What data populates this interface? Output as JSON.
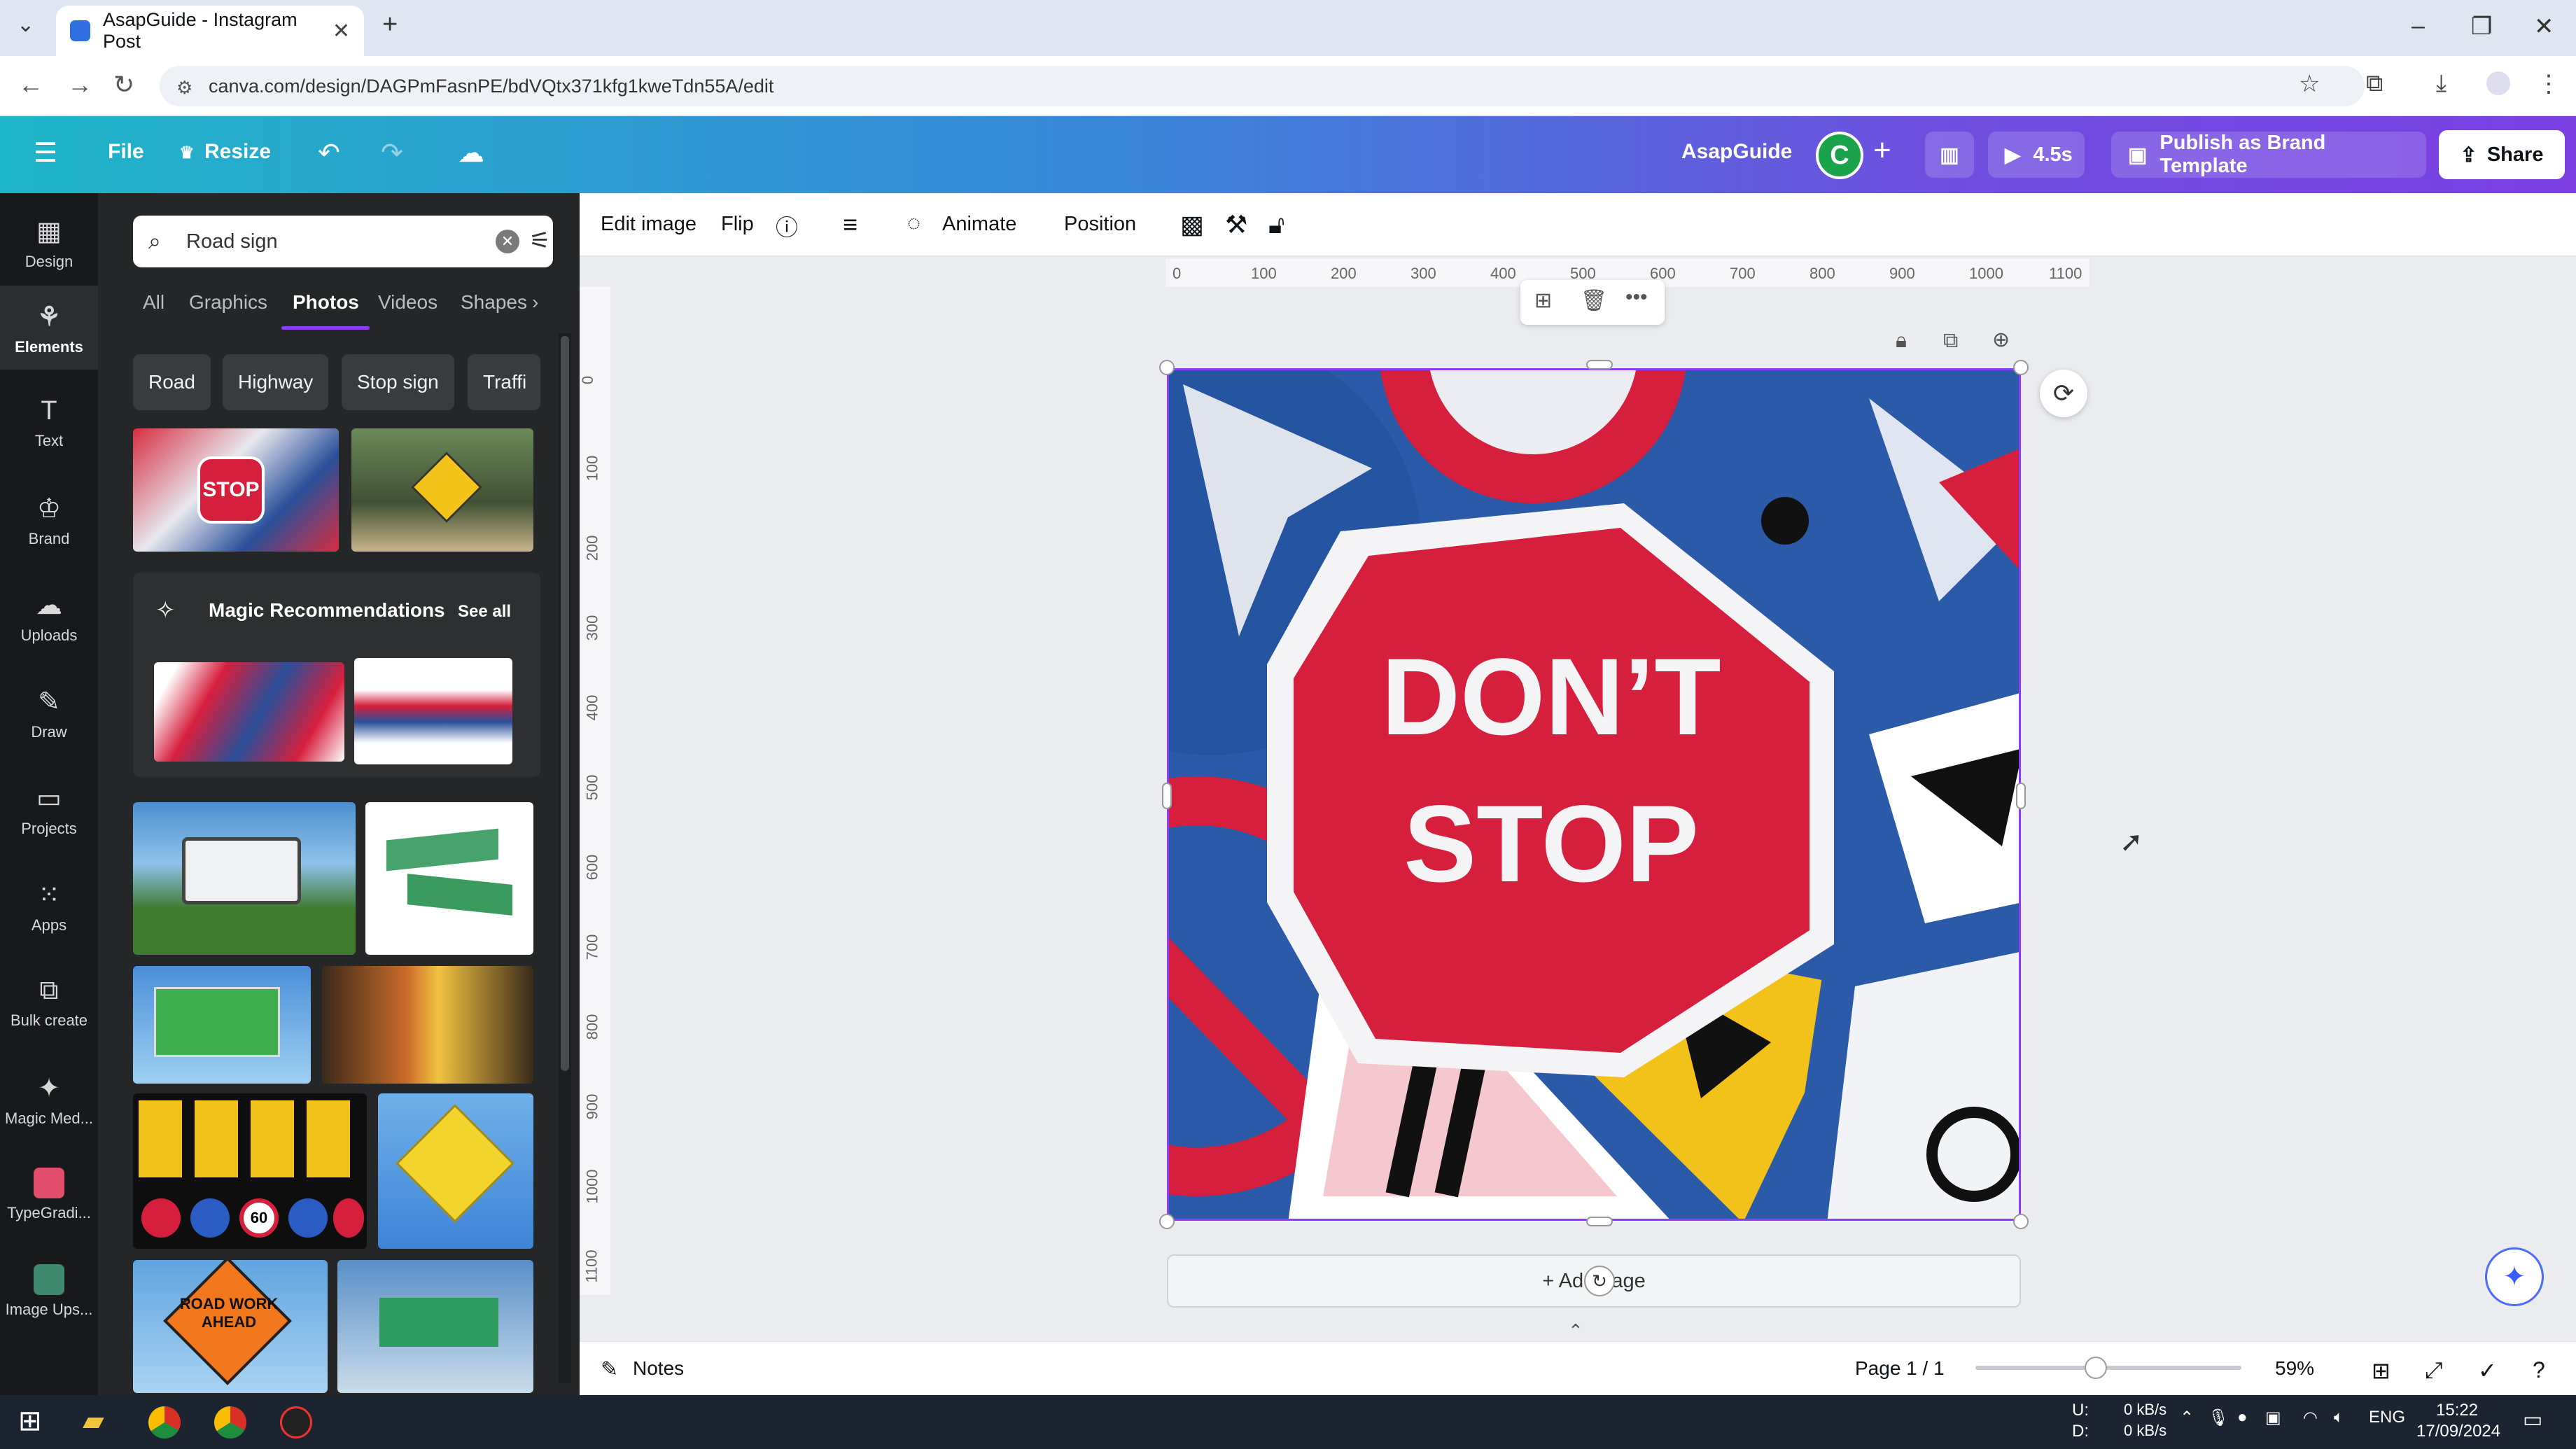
{
  "browser": {
    "tab_title": "AsapGuide - Instagram Post",
    "new_tab": "+",
    "url": "canva.com/design/DAGPmFasnPE/bdVQtx371kfg1kweTdn55A/edit",
    "window_controls": [
      "–",
      "❐",
      "✕"
    ]
  },
  "topbar": {
    "file": "File",
    "resize": "Resize",
    "brand_name": "AsapGuide",
    "avatar_letter": "C",
    "play_time": "4.5s",
    "publish": "Publish as Brand Template",
    "share": "Share"
  },
  "rail": {
    "items": [
      {
        "label": "Design",
        "icon": "design-icon"
      },
      {
        "label": "Elements",
        "icon": "elements-icon"
      },
      {
        "label": "Text",
        "icon": "text-icon"
      },
      {
        "label": "Brand",
        "icon": "brand-icon"
      },
      {
        "label": "Uploads",
        "icon": "uploads-icon"
      },
      {
        "label": "Draw",
        "icon": "draw-icon"
      },
      {
        "label": "Projects",
        "icon": "projects-icon"
      },
      {
        "label": "Apps",
        "icon": "apps-icon"
      },
      {
        "label": "Bulk create",
        "icon": "bulk-create-icon"
      },
      {
        "label": "Magic Med...",
        "icon": "magic-media-icon"
      },
      {
        "label": "TypeGradi...",
        "icon": "typegradient-icon"
      },
      {
        "label": "Image Ups...",
        "icon": "image-upscaler-icon"
      }
    ]
  },
  "panel": {
    "search_value": "Road sign",
    "tabs": [
      "All",
      "Graphics",
      "Photos",
      "Videos",
      "Shapes"
    ],
    "chips": [
      "Road",
      "Highway",
      "Stop sign",
      "Traffi"
    ],
    "magic_title": "Magic Recommendations",
    "see_all": "See all",
    "thumb_texts": {
      "stop": "STOP",
      "road_work": "ROAD WORK AHEAD",
      "speed": "60"
    }
  },
  "toolbar": {
    "edit_image": "Edit image",
    "flip": "Flip",
    "animate": "Animate",
    "position": "Position"
  },
  "ruler": {
    "h": [
      "0",
      "100",
      "200",
      "300",
      "400",
      "500",
      "600",
      "700",
      "800",
      "900",
      "1000",
      "1100"
    ],
    "v": [
      "0",
      "100",
      "200",
      "300",
      "400",
      "500",
      "600",
      "700",
      "800",
      "900",
      "1000",
      "1100"
    ]
  },
  "canvas": {
    "sign_line1": "DON’T",
    "sign_line2": "STOP",
    "add_page": "+ Add page"
  },
  "bottombar": {
    "notes": "Notes",
    "page": "Page 1 / 1",
    "zoom": "59%",
    "zoom_level": 0.59
  },
  "taskbar": {
    "net_up_label": "U:",
    "net_down_label": "D:",
    "net_up": "0 kB/s",
    "net_down": "0 kB/s",
    "lang": "ENG",
    "time": "15:22",
    "date": "17/09/2024"
  },
  "colors": {
    "accent": "#8b3dff",
    "sign_red": "#d61f3c",
    "sign_blue": "#2a5aa8"
  }
}
